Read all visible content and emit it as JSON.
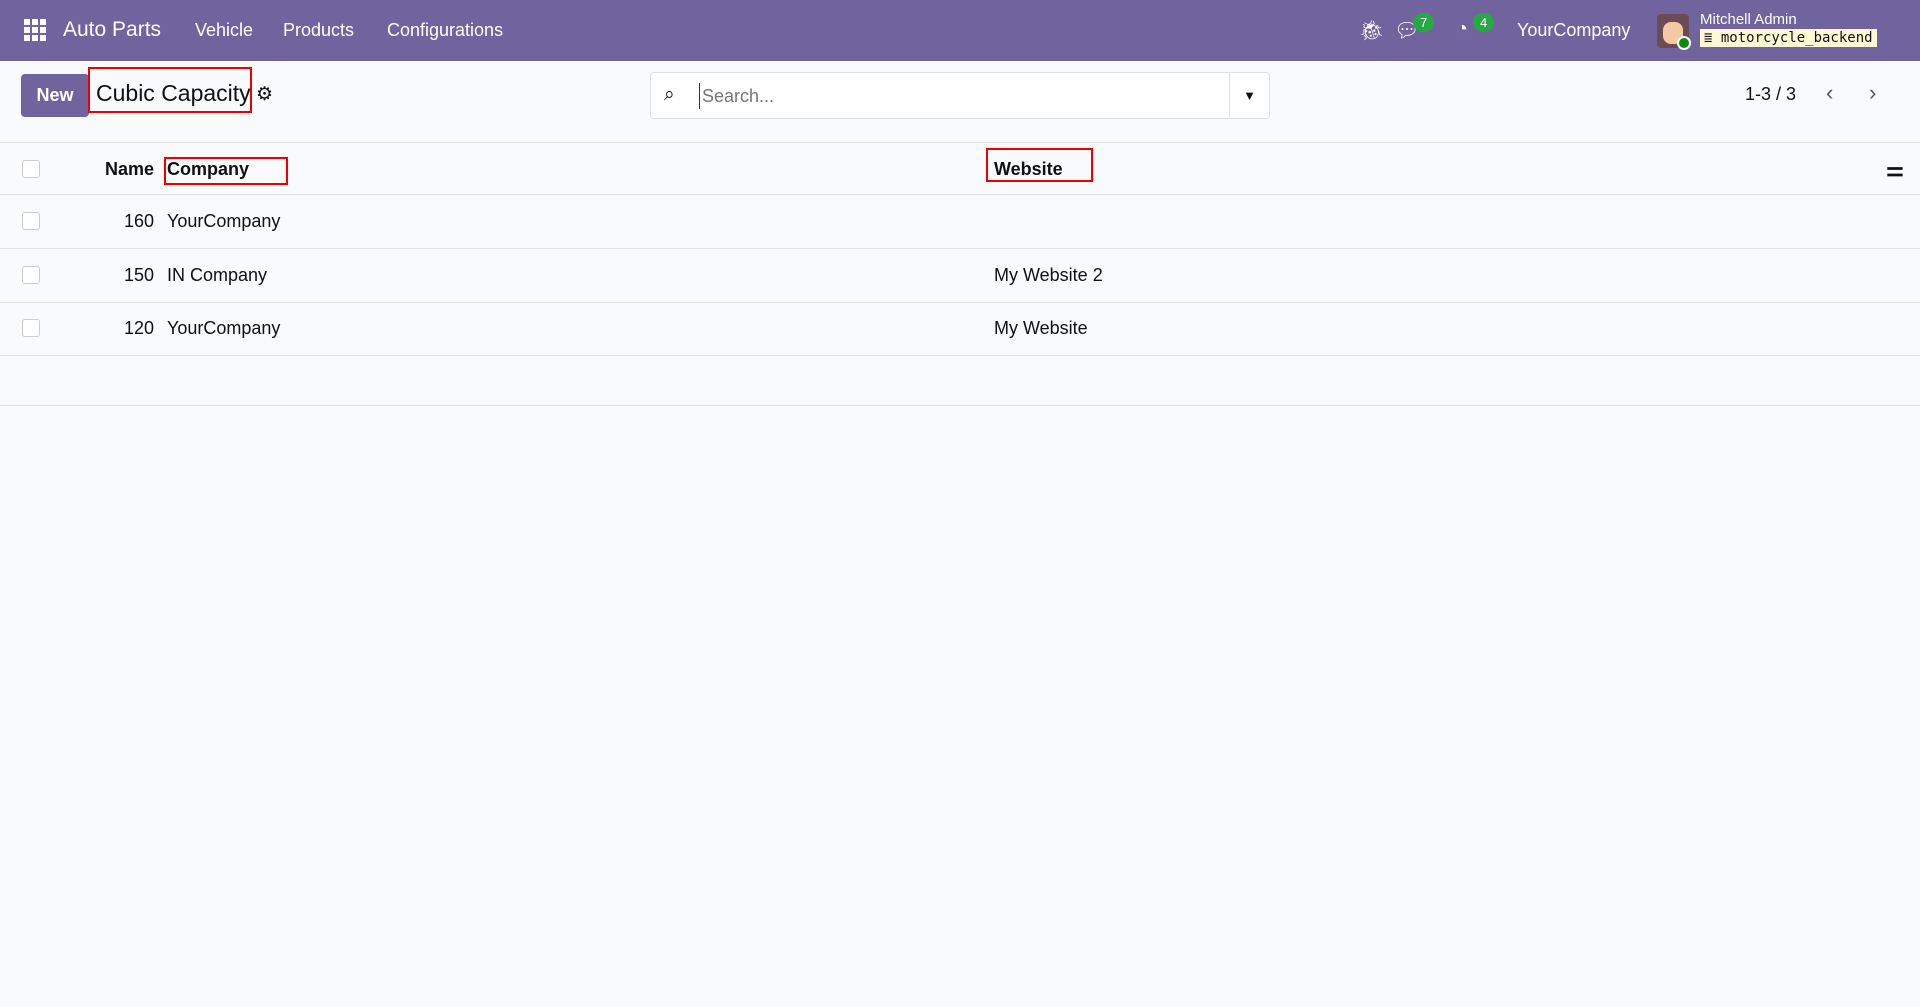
{
  "navbar": {
    "app_name": "Auto Parts",
    "menus": [
      "Vehicle",
      "Products",
      "Configurations"
    ],
    "messages_count": "7",
    "activities_count": "4",
    "company": "YourCompany",
    "user_name": "Mitchell Admin",
    "database": "motorcycle_backend"
  },
  "control": {
    "new_label": "New",
    "title": "Cubic Capacity",
    "search_placeholder": "Search...",
    "pager": "1-3 / 3"
  },
  "table": {
    "columns": [
      "Name",
      "Company",
      "Website"
    ],
    "rows": [
      {
        "name": "160",
        "company": "YourCompany",
        "website": ""
      },
      {
        "name": "150",
        "company": "IN Company",
        "website": "My Website 2"
      },
      {
        "name": "120",
        "company": "YourCompany",
        "website": "My Website"
      }
    ]
  },
  "colors": {
    "brand": "#71639e",
    "badge": "#28a745",
    "highlight": "#e00000"
  }
}
